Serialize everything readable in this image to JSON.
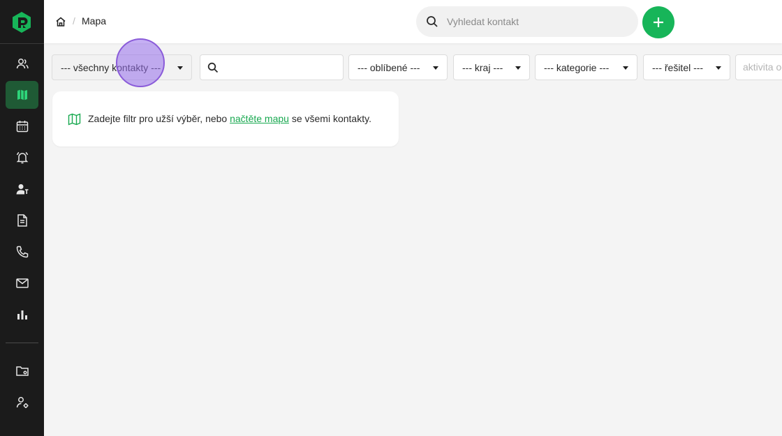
{
  "app": {
    "logo": "logo-icon",
    "accent_color": "#17b559",
    "sidebar_bg": "#1b1b1b"
  },
  "sidebar": {
    "items": [
      {
        "icon": "contacts-icon"
      },
      {
        "icon": "map-icon",
        "active": true
      },
      {
        "icon": "calendar-icon"
      },
      {
        "icon": "bell-icon"
      },
      {
        "icon": "user-assign-icon"
      },
      {
        "icon": "document-icon"
      },
      {
        "icon": "phone-icon"
      },
      {
        "icon": "mail-icon"
      },
      {
        "icon": "bar-chart-icon"
      }
    ],
    "bottom_items": [
      {
        "icon": "folder-settings-icon"
      },
      {
        "icon": "user-settings-icon"
      }
    ]
  },
  "header": {
    "breadcrumb_sep": "/",
    "title": "Mapa",
    "search_placeholder": "Vyhledat kontakt",
    "add_button": "+"
  },
  "filters": {
    "contacts": "--- všechny kontakty ---",
    "search_value": "",
    "favorites": "--- oblíbené ---",
    "region": "--- kraj ---",
    "category": "--- kategorie ---",
    "solver": "--- řešitel ---",
    "activity_placeholder": "aktivita od"
  },
  "info": {
    "text_before": "Zadejte filtr pro užší výběr, nebo ",
    "link": "načtěte mapu",
    "text_after": " se všemi kontakty."
  }
}
